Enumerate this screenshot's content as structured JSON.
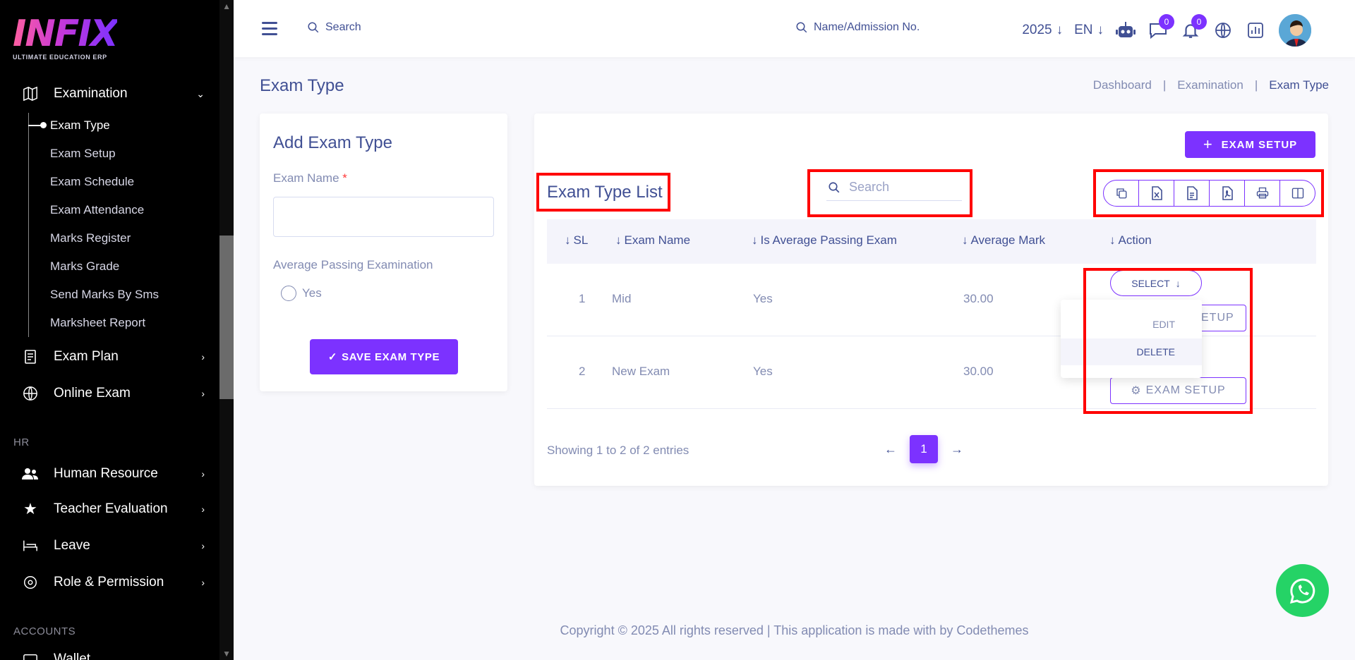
{
  "sidebar": {
    "logo_text": "INFIX",
    "logo_sub": "ULTIMATE EDUCATION ERP",
    "examination": "Examination",
    "submenu": [
      "Exam Type",
      "Exam Setup",
      "Exam Schedule",
      "Exam Attendance",
      "Marks Register",
      "Marks Grade",
      "Send Marks By Sms",
      "Marksheet Report"
    ],
    "exam_plan": "Exam Plan",
    "online_exam": "Online Exam",
    "section_hr": "HR",
    "human_resource": "Human Resource",
    "teacher_evaluation": "Teacher Evaluation",
    "leave": "Leave",
    "role_permission": "Role & Permission",
    "section_accounts": "ACCOUNTS",
    "wallet": "Wallet"
  },
  "header": {
    "search": "Search",
    "search_student": "Name/Admission No.",
    "year": "2025",
    "lang": "EN",
    "messages_count": "0",
    "notifications_count": "0"
  },
  "page": {
    "title": "Exam Type",
    "breadcrumb": [
      "Dashboard",
      "Examination",
      "Exam Type"
    ]
  },
  "add_form": {
    "title": "Add Exam Type",
    "exam_name_label": "Exam Name",
    "required_mark": "*",
    "avg_label": "Average Passing Examination",
    "radio_yes": "Yes",
    "save_button": "SAVE EXAM TYPE"
  },
  "list": {
    "setup_button": "EXAM SETUP",
    "title": "Exam Type List",
    "search_placeholder": "Search",
    "columns": [
      "SL",
      "Exam Name",
      "Is Average Passing Exam",
      "Average Mark",
      "Action"
    ],
    "rows": [
      {
        "sl": "1",
        "name": "Mid",
        "is_avg": "Yes",
        "avg_mark": "30.00"
      },
      {
        "sl": "2",
        "name": "New Exam",
        "is_avg": "Yes",
        "avg_mark": "30.00"
      }
    ],
    "select_button": "SELECT",
    "row_setup_button": "EXAM SETUP",
    "row_setup_partial": "SETUP",
    "dropdown": [
      "EDIT",
      "DELETE"
    ],
    "showing": "Showing 1 to 2 of 2 entries",
    "current_page": "1"
  },
  "footer": "Copyright © 2025 All rights reserved | This application is made with by Codethemes",
  "colors": {
    "accent": "#7c32ff",
    "text": "#415094",
    "muted": "#828bb2",
    "highlight": "#ff0000",
    "whatsapp": "#25d366"
  }
}
